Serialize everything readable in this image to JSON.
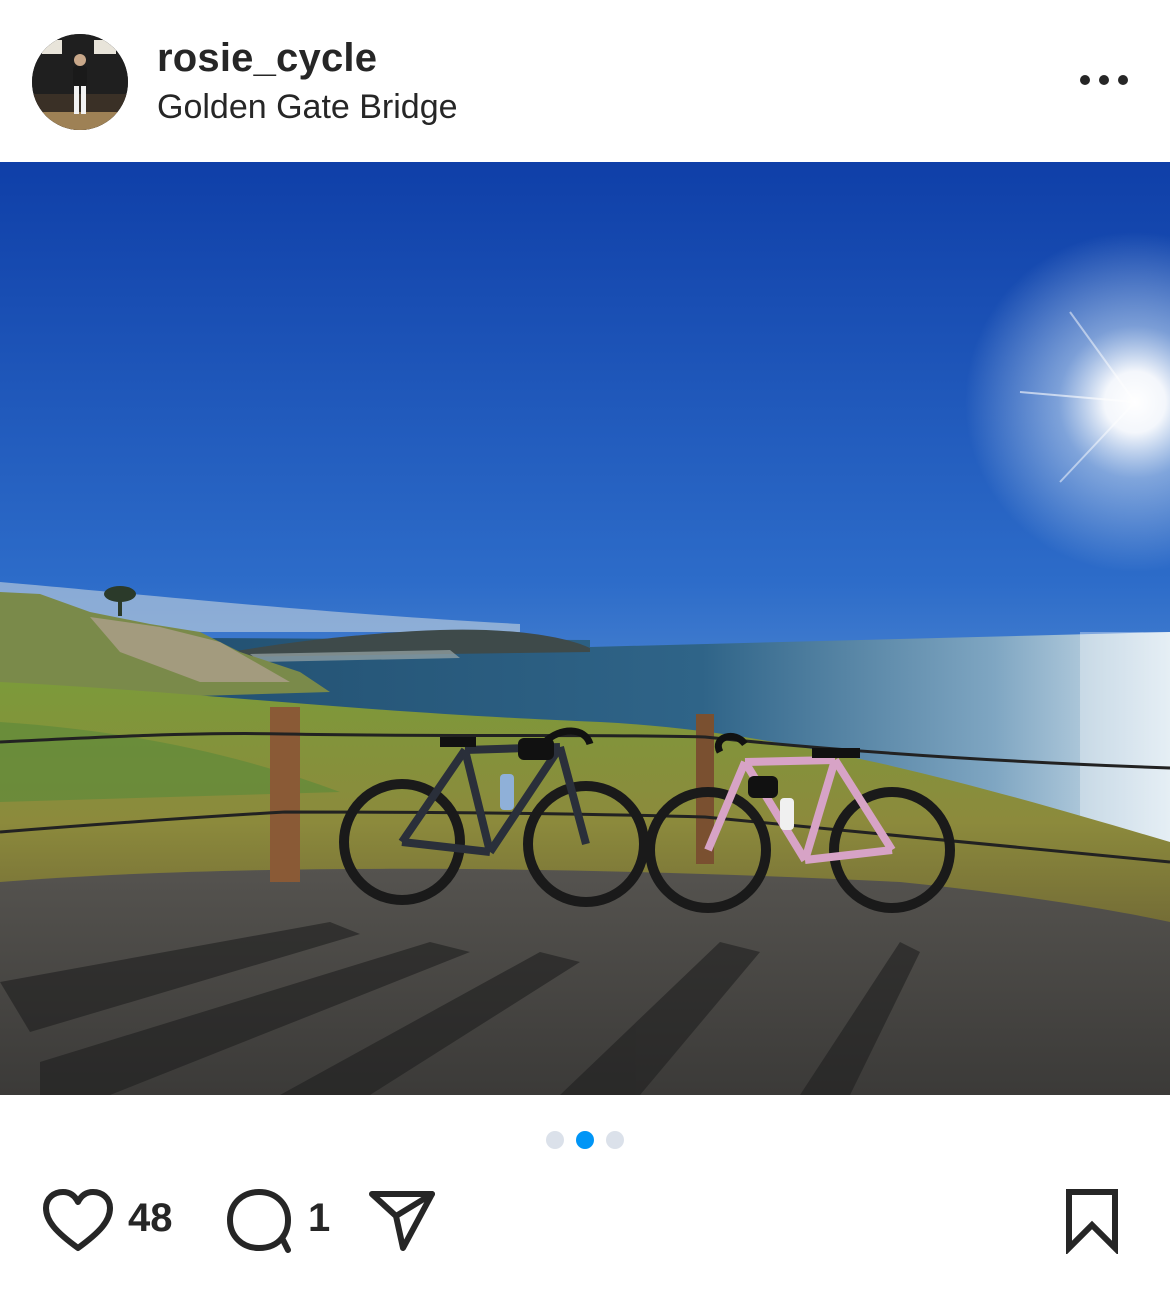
{
  "post": {
    "username": "rosie_cycle",
    "location": "Golden Gate Bridge",
    "more_icon": "more-horizontal-icon"
  },
  "carousel": {
    "total": 3,
    "active_index": 1,
    "active_color": "#0095f6",
    "inactive_color": "#dbe1ea"
  },
  "actions": {
    "like_icon": "heart-icon",
    "like_count": "48",
    "comment_icon": "comment-bubble-icon",
    "comment_count": "1",
    "share_icon": "paper-plane-icon",
    "save_icon": "bookmark-icon"
  }
}
